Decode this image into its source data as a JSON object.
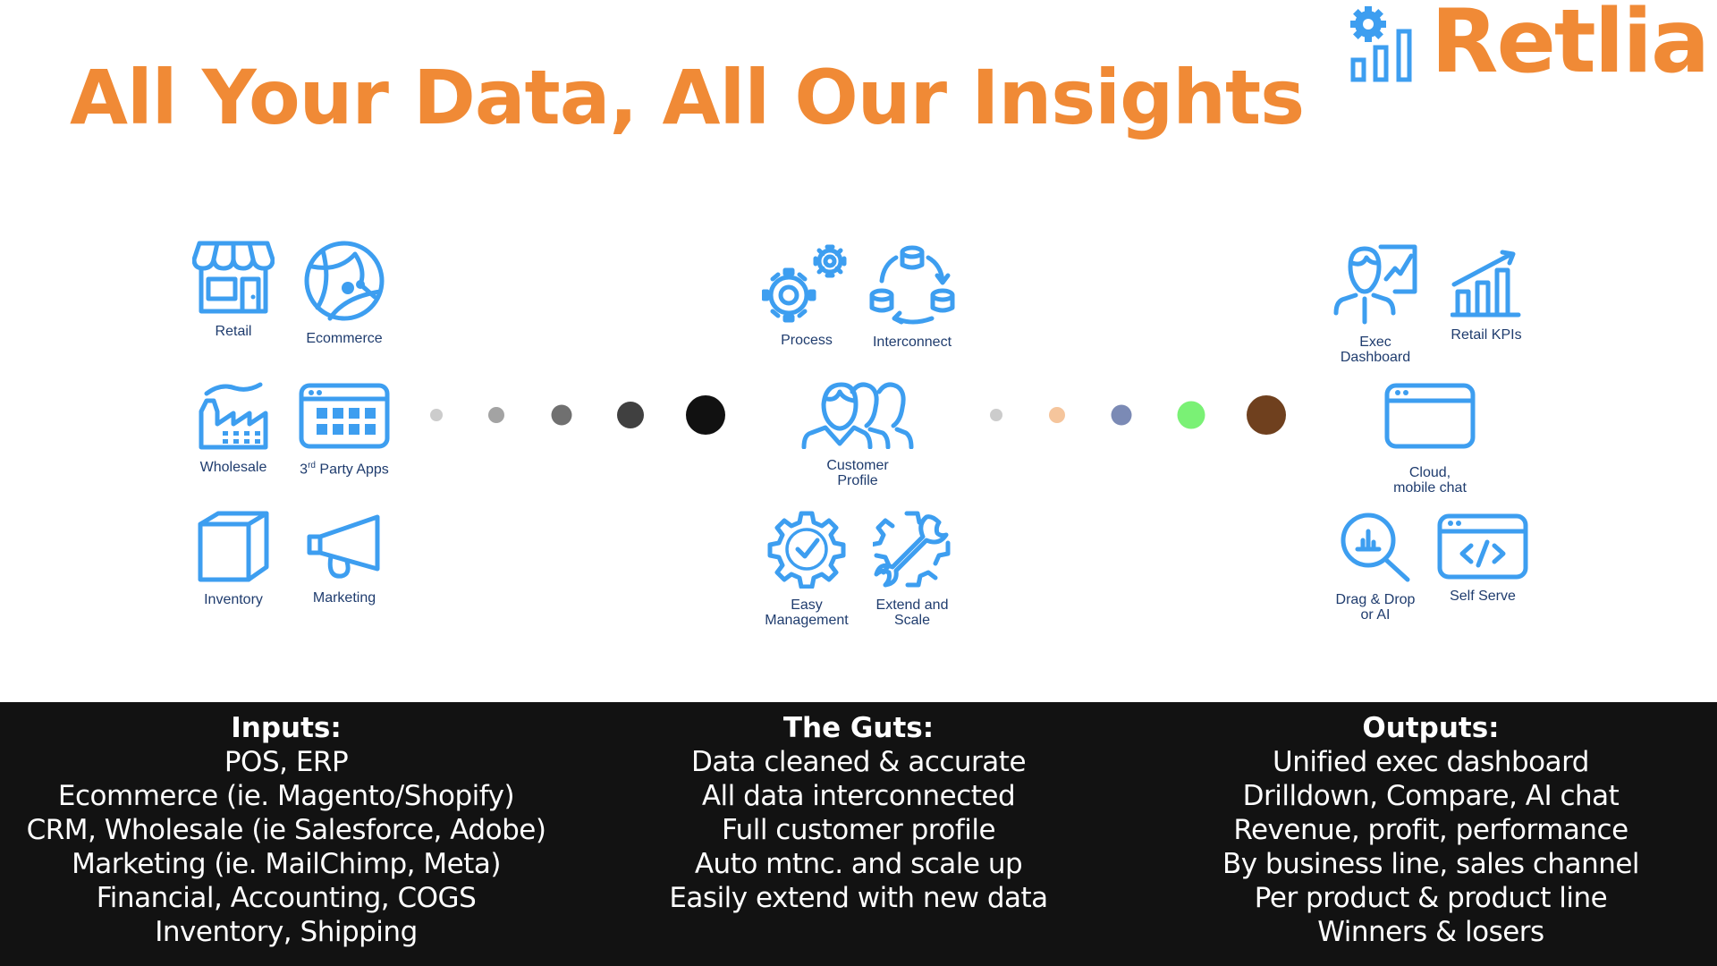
{
  "header": {
    "title": "All Your Data, All Our Insights",
    "brand": "Retlia"
  },
  "colors": {
    "accent": "#f08a36",
    "icon": "#3d9ef0",
    "label": "#1f3c6e",
    "band": "#121212"
  },
  "inputs_icons": [
    {
      "icon": "store-icon",
      "label": "Retail"
    },
    {
      "icon": "globe-icon",
      "label": "Ecommerce"
    },
    {
      "icon": "factory-icon",
      "label": "Wholesale"
    },
    {
      "icon": "app-grid-icon",
      "label_prefix": "3",
      "label_sup": "rd",
      "label": " Party Apps"
    },
    {
      "icon": "box-icon",
      "label": "Inventory"
    },
    {
      "icon": "megaphone-icon",
      "label": "Marketing"
    }
  ],
  "guts_icons": [
    {
      "icon": "gears-icon",
      "label": "Process"
    },
    {
      "icon": "database-cycle-icon",
      "label": "Interconnect"
    },
    {
      "icon": "people-icon",
      "label": "Customer\nProfile"
    },
    {
      "icon": "gear-check-icon",
      "label": "Easy\nManagement"
    },
    {
      "icon": "gear-wrench-icon",
      "label": "Extend and\nScale"
    }
  ],
  "outputs_icons": [
    {
      "icon": "presenter-chart-icon",
      "label": "Exec\nDashboard"
    },
    {
      "icon": "bar-chart-up-icon",
      "label": "Retail KPIs"
    },
    {
      "icon": "browser-window-icon",
      "label": "Cloud,\nmobile chat"
    },
    {
      "icon": "magnify-chart-icon",
      "label": "Drag & Drop\nor AI"
    },
    {
      "icon": "code-window-icon",
      "label": "Self Serve"
    }
  ],
  "flow_dots_left": [
    "#cccccc",
    "#a3a3a3",
    "#707070",
    "#404040",
    "#111111"
  ],
  "flow_dots_right": [
    "#cccccc",
    "#f5c59c",
    "#7b8ab5",
    "#7af175",
    "#6f401e"
  ],
  "summary": {
    "inputs": {
      "heading": "Inputs:",
      "lines": [
        "POS, ERP",
        "Ecommerce (ie. Magento/Shopify)",
        "CRM, Wholesale (ie Salesforce, Adobe)",
        "Marketing (ie. MailChimp, Meta)",
        "Financial, Accounting, COGS",
        "Inventory, Shipping"
      ]
    },
    "guts": {
      "heading": "The Guts:",
      "lines": [
        "Data cleaned & accurate",
        "All data interconnected",
        "Full customer profile",
        "Auto mtnc. and scale up",
        "Easily extend with new data"
      ]
    },
    "outputs": {
      "heading": "Outputs:",
      "lines": [
        "Unified exec dashboard",
        "Drilldown, Compare, AI chat",
        "Revenue, profit, performance",
        "By business line, sales channel",
        "Per product & product line",
        "Winners & losers"
      ]
    }
  }
}
